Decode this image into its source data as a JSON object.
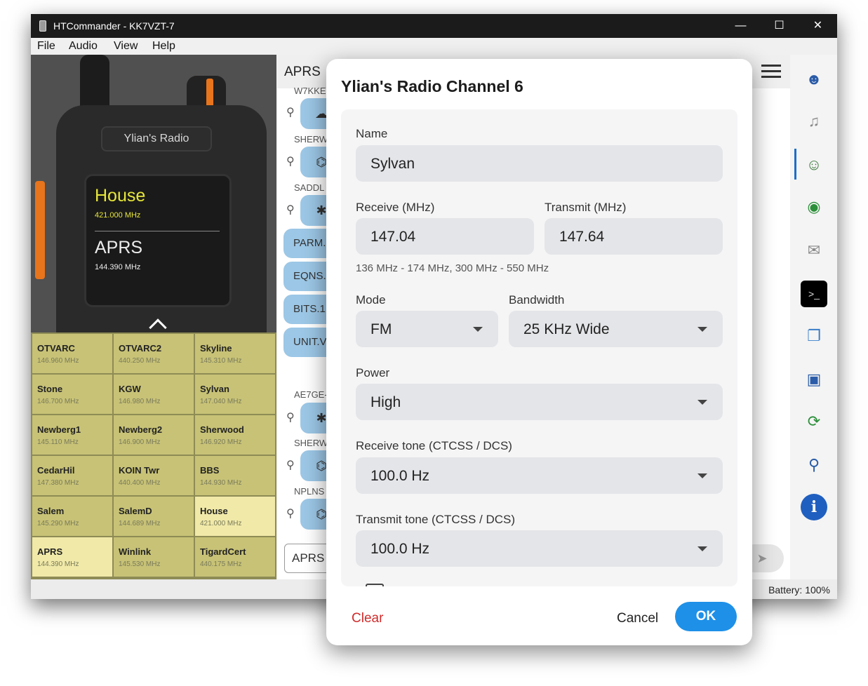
{
  "window": {
    "title": "HTCommander - KK7VZT-7",
    "controls": {
      "minimize": "—",
      "maximize": "☐",
      "close": "✕"
    }
  },
  "menu": [
    "File",
    "Audio",
    "View",
    "Help"
  ],
  "radio": {
    "brand": "Ylian's Radio",
    "vfo_a": {
      "name": "House",
      "freq": "421.000 MHz"
    },
    "vfo_b": {
      "name": "APRS",
      "freq": "144.390 MHz"
    }
  },
  "channels": [
    {
      "name": "OTVARC",
      "freq": "146.960 MHz"
    },
    {
      "name": "OTVARC2",
      "freq": "440.250 MHz"
    },
    {
      "name": "Skyline",
      "freq": "145.310 MHz"
    },
    {
      "name": "Stone",
      "freq": "146.700 MHz"
    },
    {
      "name": "KGW",
      "freq": "146.980 MHz"
    },
    {
      "name": "Sylvan",
      "freq": "147.040 MHz"
    },
    {
      "name": "Newberg1",
      "freq": "145.110 MHz"
    },
    {
      "name": "Newberg2",
      "freq": "146.900 MHz"
    },
    {
      "name": "Sherwood",
      "freq": "146.920 MHz"
    },
    {
      "name": "CedarHil",
      "freq": "147.380 MHz"
    },
    {
      "name": "KOIN Twr",
      "freq": "440.400 MHz"
    },
    {
      "name": "BBS",
      "freq": "144.930 MHz"
    },
    {
      "name": "Salem",
      "freq": "145.290 MHz"
    },
    {
      "name": "SalemD",
      "freq": "144.689 MHz"
    },
    {
      "name": "House",
      "freq": "421.000 MHz",
      "selected": true
    },
    {
      "name": "APRS",
      "freq": "144.390 MHz",
      "selected": true
    },
    {
      "name": "Winlink",
      "freq": "145.530 MHz"
    },
    {
      "name": "TigardCert",
      "freq": "440.175 MHz"
    }
  ],
  "aprs": {
    "title": "APRS",
    "callsigns": [
      "W7KKE",
      "SHERW",
      "SADDL",
      "AE7GE-",
      "SHERW",
      "NPLNS"
    ],
    "bubble_icons": [
      "cloud-icon",
      "antenna-icon",
      "star-icon",
      "star-icon",
      "antenna-icon",
      "antenna-icon"
    ],
    "messages": [
      "PARM.",
      "EQNS.",
      "BITS.1",
      "UNIT.V"
    ],
    "input_value": "APRS",
    "send_icon": "➤"
  },
  "sidebar_icons": [
    "user-icon",
    "microphone-icon",
    "contacts-icon",
    "globe-icon",
    "mail-icon",
    "terminal-icon",
    "windows-icon",
    "network-icon",
    "sync-icon",
    "search-icon",
    "info-icon"
  ],
  "status": {
    "battery": "Battery: 100%"
  },
  "dialog": {
    "title": "Ylian's Radio Channel 6",
    "name_label": "Name",
    "name_value": "Sylvan",
    "receive_label": "Receive (MHz)",
    "receive_value": "147.04",
    "transmit_label": "Transmit (MHz)",
    "transmit_value": "147.64",
    "range_hint": "136 MHz - 174 MHz, 300 MHz - 550 MHz",
    "mode_label": "Mode",
    "mode_value": "FM",
    "bandwidth_label": "Bandwidth",
    "bandwidth_value": "25 KHz Wide",
    "power_label": "Power",
    "power_value": "High",
    "rx_tone_label": "Receive tone (CTCSS / DCS)",
    "rx_tone_value": "100.0 Hz",
    "tx_tone_label": "Transmit tone (CTCSS / DCS)",
    "tx_tone_value": "100.0 Hz",
    "clear_label": "Clear",
    "cancel_label": "Cancel",
    "ok_label": "OK"
  },
  "colors": {
    "accent": "#1e90e8",
    "clear": "#d12b2b",
    "channel_cell": "#c7c276",
    "channel_selected": "#f0e9a8",
    "radio_display_active": "#e6e63a",
    "aprs_bubble": "#9cc7e6"
  }
}
